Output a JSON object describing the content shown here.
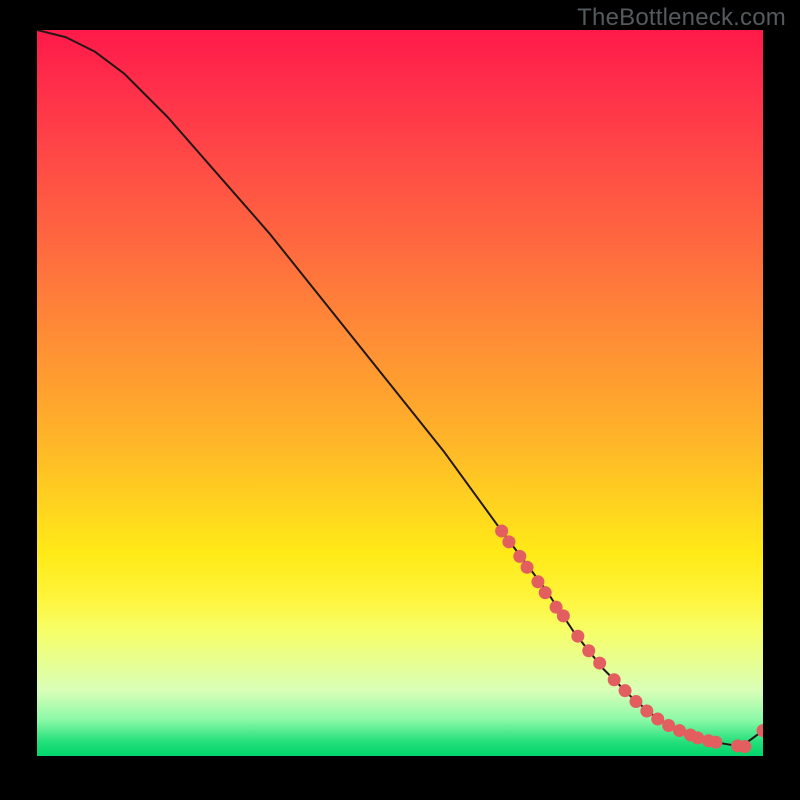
{
  "watermark": "TheBottleneck.com",
  "colors": {
    "line": "#231815",
    "marker": "#e35e5f",
    "background": "#000000"
  },
  "chart_data": {
    "type": "line",
    "title": "",
    "xlabel": "",
    "ylabel": "",
    "xlim": [
      0,
      100
    ],
    "ylim": [
      0,
      100
    ],
    "grid": false,
    "legend": false,
    "series": [
      {
        "name": "curve",
        "kind": "line",
        "x": [
          0,
          4,
          8,
          12,
          18,
          25,
          32,
          40,
          48,
          56,
          64,
          70,
          74,
          78,
          82,
          85,
          88,
          91,
          94,
          97,
          100
        ],
        "y": [
          100,
          99,
          97,
          94,
          88,
          80,
          72,
          62,
          52,
          42,
          31,
          23,
          17,
          12,
          8,
          5.5,
          3.7,
          2.5,
          1.8,
          1.3,
          3.5
        ]
      },
      {
        "name": "markers",
        "kind": "scatter",
        "x": [
          64.0,
          65.0,
          66.5,
          67.5,
          69.0,
          70.0,
          71.5,
          72.5,
          74.5,
          76.0,
          77.5,
          79.5,
          81.0,
          82.5,
          84.0,
          85.5,
          87.0,
          88.5,
          90.0,
          91.0,
          92.5,
          93.5,
          96.5,
          97.5,
          100.0
        ],
        "y": [
          31.0,
          29.5,
          27.5,
          26.0,
          24.0,
          22.5,
          20.5,
          19.3,
          16.5,
          14.5,
          12.8,
          10.5,
          9.0,
          7.5,
          6.2,
          5.1,
          4.2,
          3.5,
          2.9,
          2.5,
          2.1,
          1.9,
          1.4,
          1.3,
          3.5
        ]
      }
    ]
  }
}
